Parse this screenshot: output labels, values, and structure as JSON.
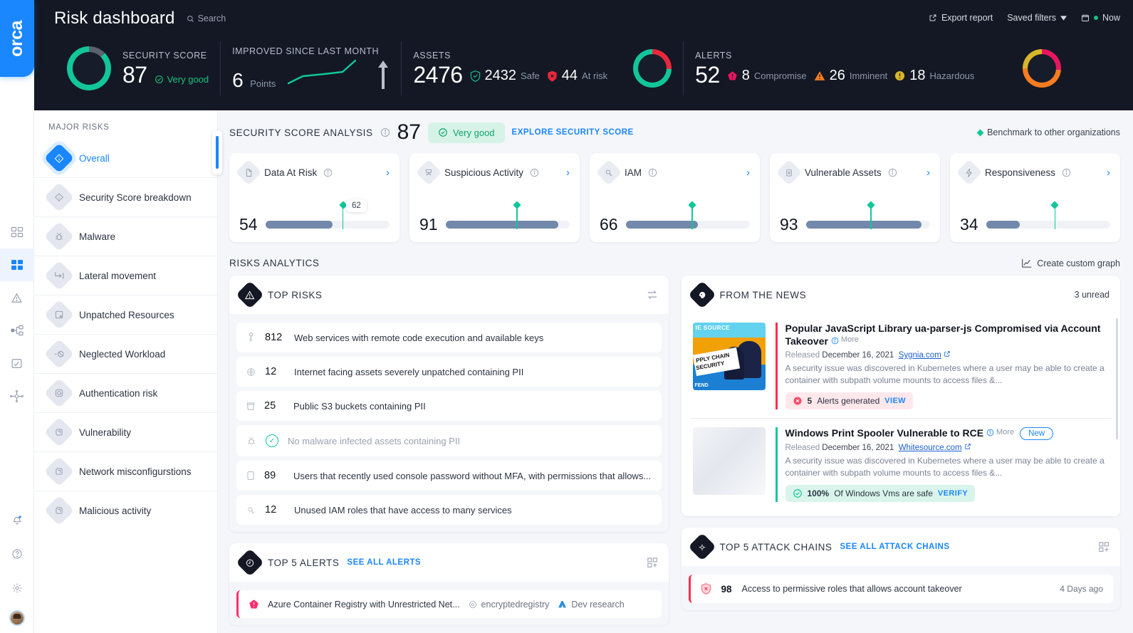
{
  "brand": {
    "logo_text": "orca",
    "accent": "#1a86ff"
  },
  "rail": {
    "items": [
      {
        "name": "dashboards-icon",
        "label": "Dashboards"
      },
      {
        "name": "apps-grid-icon",
        "label": "Inventory"
      },
      {
        "name": "alerts-warning-icon",
        "label": "Alerts"
      },
      {
        "name": "network-topology-icon",
        "label": "Topology"
      },
      {
        "name": "compliance-clipboard-icon",
        "label": "Compliance"
      },
      {
        "name": "attack-path-icon",
        "label": "Attack paths"
      }
    ],
    "bottom": [
      {
        "name": "notification-bell-icon",
        "label": "Notifications"
      },
      {
        "name": "help-icon",
        "label": "Help"
      },
      {
        "name": "settings-gear-icon",
        "label": "Settings"
      },
      {
        "name": "user-avatar",
        "label": "Account"
      }
    ]
  },
  "header": {
    "title": "Risk dashboard",
    "search_label": "Search",
    "actions": {
      "export": "Export report",
      "saved_filters": "Saved filters",
      "time_range": "Now"
    },
    "kpis": {
      "security_score": {
        "label": "SECURITY SCORE",
        "value": "87",
        "status": "Very good",
        "gauge_percent": 87,
        "gauge_color": "#11c79a"
      },
      "improved": {
        "label": "IMPROVED SINCE LAST MONTH",
        "value": "6",
        "unit": "Points",
        "trend_color": "#11c79a"
      },
      "assets": {
        "label": "ASSETS",
        "value": "2476",
        "safe_value": "2432",
        "safe_label": "Safe",
        "at_risk_value": "44",
        "at_risk_label": "At risk",
        "safe_color": "#11c79a",
        "risk_color": "#e8283c",
        "safe_percent": 72
      },
      "alerts": {
        "label": "ALERTS",
        "value": "52",
        "breakdown": [
          {
            "value": "8",
            "label": "Compromise",
            "color": "#e8165f"
          },
          {
            "value": "26",
            "label": "Imminent",
            "color": "#f57c20"
          },
          {
            "value": "18",
            "label": "Hazardous",
            "color": "#d8b62a"
          }
        ]
      }
    }
  },
  "major_risks": {
    "title": "MAJOR RISKS",
    "items": [
      {
        "label": "Overall",
        "icon": "overall-diamond-icon",
        "active": true
      },
      {
        "label": "Security Score breakdown",
        "icon": "score-breakdown-icon",
        "active": false
      },
      {
        "label": "Malware",
        "icon": "malware-bug-icon",
        "active": false
      },
      {
        "label": "Lateral movement",
        "icon": "lateral-movement-icon",
        "active": false
      },
      {
        "label": "Unpatched Resources",
        "icon": "unpatched-resources-icon",
        "active": false
      },
      {
        "label": "Neglected Workload",
        "icon": "neglected-workload-icon",
        "active": false
      },
      {
        "label": "Authentication risk",
        "icon": "authentication-risk-icon",
        "active": false
      },
      {
        "label": "Vulnerability",
        "icon": "vulnerability-icon",
        "active": false
      },
      {
        "label": "Network misconfigurstions",
        "icon": "network-misconfig-icon",
        "active": false
      },
      {
        "label": "Malicious activity",
        "icon": "malicious-activity-icon",
        "active": false
      }
    ]
  },
  "security_score_analysis": {
    "title": "SECURITY SCORE ANALYSIS",
    "score": "87",
    "status": "Very good",
    "explore_link": "EXPLORE SECURITY SCORE",
    "benchmark_label": "Benchmark to other organizations",
    "cards": [
      {
        "name": "Data At Risk",
        "value": "54",
        "fill_percent": 54,
        "benchmark": 62,
        "benchmark_label": "62",
        "icon": "file-data-icon"
      },
      {
        "name": "Suspicious Activity",
        "value": "91",
        "fill_percent": 91,
        "benchmark": 57,
        "benchmark_label": "",
        "icon": "suspicious-activity-icon"
      },
      {
        "name": "IAM",
        "value": "66",
        "fill_percent": 58,
        "benchmark": 53,
        "benchmark_label": "",
        "icon": "iam-key-icon"
      },
      {
        "name": "Vulnerable Assets",
        "value": "93",
        "fill_percent": 93,
        "benchmark": 52,
        "benchmark_label": "",
        "icon": "vulnerable-assets-icon"
      },
      {
        "name": "Responsiveness",
        "value": "34",
        "fill_percent": 27,
        "benchmark": 55,
        "benchmark_label": "",
        "icon": "responsiveness-bolt-icon"
      }
    ]
  },
  "risks_analytics": {
    "title": "RISKS ANALYTICS",
    "custom_graph": "Create custom graph"
  },
  "top_risks": {
    "title": "TOP RISKS",
    "rows": [
      {
        "count": "812",
        "text": "Web services with remote code execution and available keys",
        "icon": "key-icon",
        "muted": false
      },
      {
        "count": "12",
        "text": "Internet facing assets severely unpatched containing PII",
        "icon": "globe-icon",
        "muted": false
      },
      {
        "count": "25",
        "text": "Public S3 buckets containing PII",
        "icon": "bucket-icon",
        "muted": false
      },
      {
        "count": "",
        "text": "No malware infected assets containing PII",
        "icon": "malware-bug-icon",
        "muted": true,
        "check": true
      },
      {
        "count": "89",
        "text": "Users that recently used console password without MFA, with permissions that allows...",
        "icon": "user-doc-icon",
        "muted": false
      },
      {
        "count": "12",
        "text": "Unused IAM roles that have access to many services",
        "icon": "iam-key-icon",
        "muted": false
      }
    ]
  },
  "from_the_news": {
    "title": "FROM THE NEWS",
    "unread": "3 unread",
    "items": [
      {
        "headline": "Popular JavaScript Library ua-parser-js Compromised via Account Takeover",
        "more": "More",
        "released_prefix": "Released",
        "released_date": "December 16, 2021",
        "source": "Sygnia.com",
        "description": "A security issue was discovered in Kubernetes where a user may be able to create a container with subpath volume mounts to access files &...",
        "chip_value": "5",
        "chip_text": "Alerts generated",
        "chip_action": "VIEW",
        "chip_style": "red",
        "accent": "#ff2d4b",
        "badge": ""
      },
      {
        "headline": "Windows Print Spooler Vulnerable to RCE",
        "more": "More",
        "released_prefix": "Released",
        "released_date": "December 16, 2021",
        "source": "Whitesource.com",
        "description": "A security issue was discovered in Kubernetes where a user may be able to create a container with subpath volume mounts to access files &...",
        "chip_value": "100%",
        "chip_text": "Of Windows Vms are safe",
        "chip_action": "VERIFY",
        "chip_style": "green",
        "accent": "#11c79a",
        "badge": "New"
      }
    ]
  },
  "top_alerts": {
    "title": "TOP 5 ALERTS",
    "see_all": "SEE ALL ALERTS",
    "rows": [
      {
        "text": "Azure Container Registry with Unrestricted Net...",
        "asset": "encryptedregistry",
        "tag": "Dev research",
        "severity_color": "#ff2d6a"
      }
    ]
  },
  "top_attack_chains": {
    "title": "TOP 5 ATTACK CHAINS",
    "see_all": "SEE ALL ATTACK CHAINS",
    "rows": [
      {
        "score": "98",
        "text": "Access to permissive roles that allows account takeover",
        "time": "4 Days ago",
        "severity_color": "#ff2d4b"
      }
    ]
  }
}
